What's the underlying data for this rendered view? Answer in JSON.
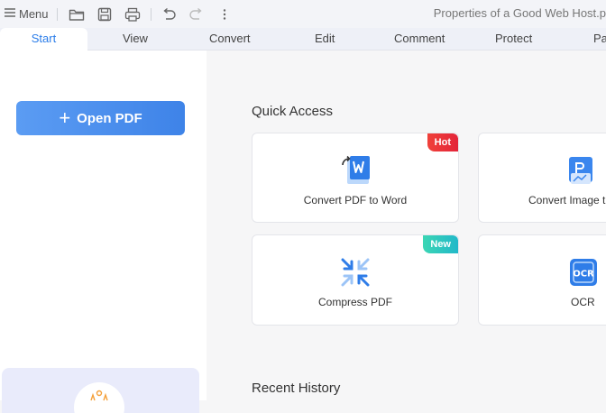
{
  "toolbar": {
    "menu_label": "Menu",
    "icons": [
      "menu-icon",
      "folder-icon",
      "save-icon",
      "print-icon",
      "undo-icon",
      "redo-icon",
      "more-icon"
    ],
    "document_title": "Properties of a Good Web Host.p"
  },
  "tabs": [
    {
      "label": "Start",
      "active": true
    },
    {
      "label": "View"
    },
    {
      "label": "Convert"
    },
    {
      "label": "Edit"
    },
    {
      "label": "Comment"
    },
    {
      "label": "Protect"
    },
    {
      "label": "Pa"
    }
  ],
  "sidebar": {
    "open_pdf_label": "Open PDF"
  },
  "main": {
    "quick_access_title": "Quick Access",
    "cards": [
      {
        "label": "Convert PDF to Word",
        "badge": "Hot"
      },
      {
        "label": "Convert Image t"
      },
      {
        "label": "Compress PDF",
        "badge": "New"
      },
      {
        "label": "OCR"
      }
    ],
    "recent_history_title": "Recent History"
  },
  "colors": {
    "accent": "#2b7de9",
    "button": "#4a8fee",
    "hot_badge": "#e92f3a",
    "new_badge": "#2cc7bf"
  }
}
